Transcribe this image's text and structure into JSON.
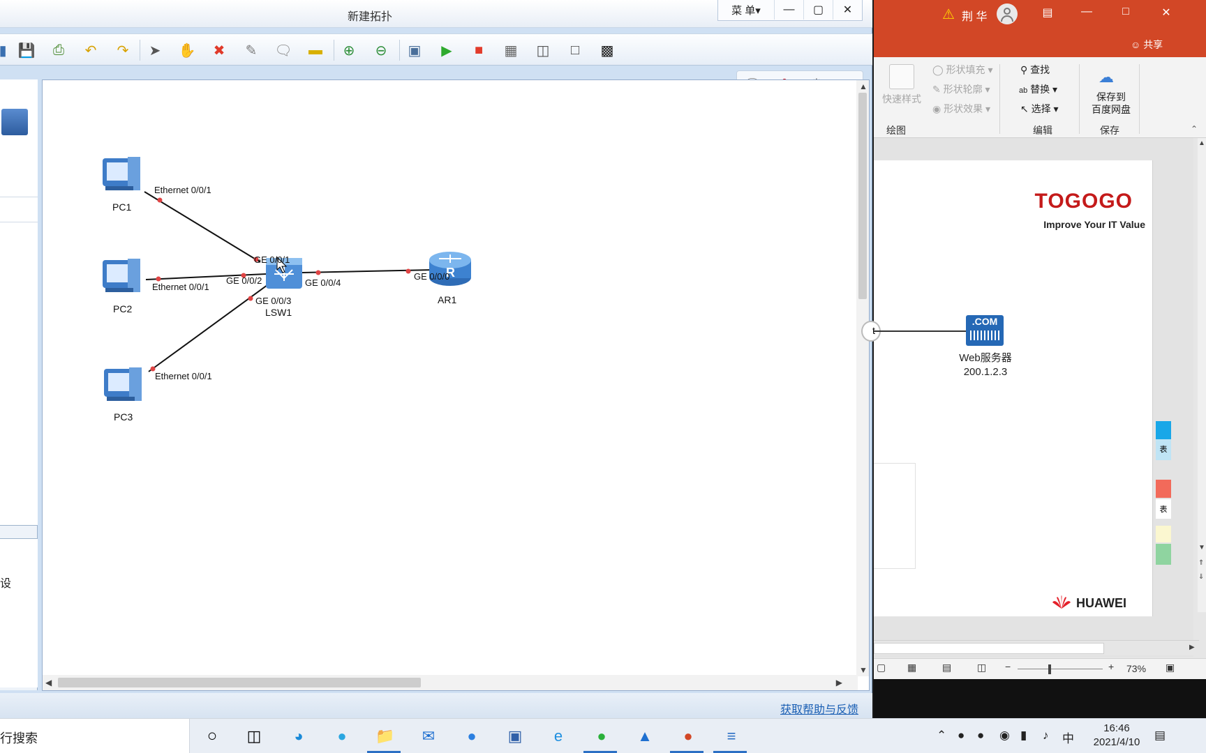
{
  "ensp": {
    "title": "新建拓扑",
    "menu_label": "菜 单▾",
    "help_link": "获取帮助与反馈",
    "topology": {
      "devices": [
        {
          "id": "PC1",
          "label": "PC1",
          "type": "pc"
        },
        {
          "id": "PC2",
          "label": "PC2",
          "type": "pc"
        },
        {
          "id": "PC3",
          "label": "PC3",
          "type": "pc"
        },
        {
          "id": "LSW1",
          "label": "LSW1",
          "type": "switch"
        },
        {
          "id": "AR1",
          "label": "AR1",
          "type": "router"
        }
      ],
      "ports": {
        "pc1_port": "Ethernet 0/0/1",
        "pc2_port": "Ethernet 0/0/1",
        "pc3_port": "Ethernet 0/0/1",
        "lsw_port1": "GE 0/0/1",
        "lsw_port2": "GE 0/0/2",
        "lsw_port3": "GE 0/0/3",
        "lsw_port4": "GE 0/0/4",
        "ar_port": "GE 0/0/0"
      }
    }
  },
  "word": {
    "user": "荆 华",
    "share": "共享",
    "ribbon": {
      "shape_fill": "形状填充",
      "shape_outline": "形状轮廓",
      "shape_effect": "形状效果",
      "quick_style": "快速样式",
      "find": "查找",
      "replace": "替换",
      "select": "选择",
      "save_to": "保存到",
      "baidu_disk": "百度网盘",
      "group_draw": "绘图",
      "group_edit": "编辑",
      "group_save": "保存"
    },
    "slide": {
      "brand": "TOGOGO",
      "slogan": "Improve Your IT Value",
      "web_icon_text": ".COM",
      "web_label": "Web服务器",
      "web_ip": "200.1.2.3",
      "partial_text": "t",
      "footer_brand": "HUAWEI"
    },
    "zoom": "73%",
    "side_marks": [
      "表",
      "表"
    ]
  },
  "taskbar": {
    "search_text": "行搜索",
    "ime": "中",
    "time": "16:46",
    "date": "2021/4/10"
  },
  "left_panel_text": "设"
}
